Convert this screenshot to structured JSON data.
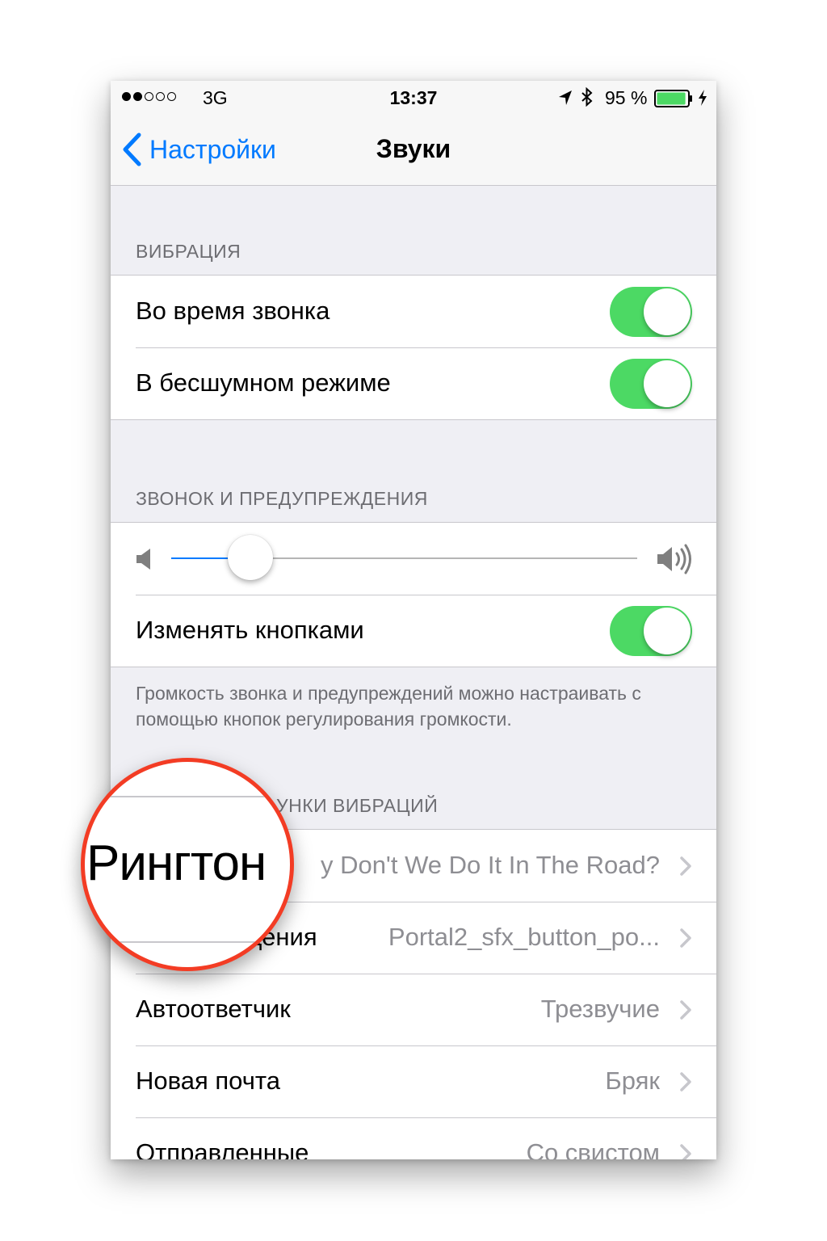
{
  "status_bar": {
    "signal_filled": 2,
    "signal_total": 5,
    "carrier": "3G",
    "time": "13:37",
    "battery": "95 %",
    "battery_level": 0.95,
    "icons": [
      "location-arrow-icon",
      "bluetooth-icon",
      "battery-icon",
      "charging-bolt-icon"
    ]
  },
  "nav": {
    "back_label": "Настройки",
    "title": "Звуки"
  },
  "vibration": {
    "header": "ВИБРАЦИЯ",
    "rows": [
      {
        "label": "Во время звонка",
        "on": true
      },
      {
        "label": "В бесшумном режиме",
        "on": true
      }
    ]
  },
  "ringer": {
    "header": "ЗВОНОК И ПРЕДУПРЕЖДЕНИЯ",
    "volume_level": 0.17,
    "change_with_buttons_label": "Изменять кнопками",
    "change_with_buttons_on": true,
    "footer": "Громкость звонка и предупреждений можно настраивать с помощью кнопок регулирования громкости."
  },
  "patterns": {
    "header_visible": "УНКИ ВИБРАЦИЙ",
    "rows": [
      {
        "label": "",
        "value": "y Don't We Do It In The Road?"
      },
      {
        "label": "щения",
        "value": "Portal2_sfx_button_po..."
      },
      {
        "label": "Автоответчик",
        "value": "Трезвучие"
      },
      {
        "label": "Новая почта",
        "value": "Бряк"
      },
      {
        "label": "Отправленные",
        "value": "Со свистом"
      }
    ]
  },
  "magnifier": {
    "text": "Рингтон",
    "ring_color": "#f33c24"
  },
  "colors": {
    "accent": "#007aff",
    "toggle_on": "#4cd964"
  }
}
